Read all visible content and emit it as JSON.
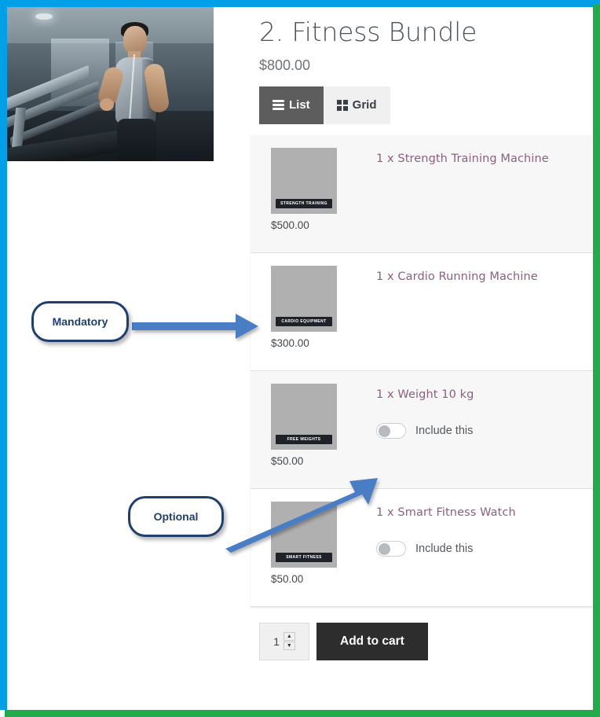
{
  "frame": {
    "top_color": "#00a0e9",
    "left_color": "#00a0e9",
    "right_color": "#22aa4b",
    "bottom_color": "#22aa4b"
  },
  "hero": {
    "alt": "man running on treadmill in gym",
    "icon": "hero-photo"
  },
  "bundle": {
    "title": "2. Fitness Bundle",
    "price": "$800.00"
  },
  "view_switch": {
    "list_label": "List",
    "grid_label": "Grid",
    "active": "List"
  },
  "products": [
    {
      "title": "1 x Strength Training Machine",
      "price": "$500.00",
      "badge": "STRENGTH TRAINING",
      "has_toggle": false,
      "toggle_label": "",
      "toggle_on": false,
      "shaded": true
    },
    {
      "title": "1 x Cardio Running Machine",
      "price": "$300.00",
      "badge": "CARDIO EQUIPMENT",
      "has_toggle": false,
      "toggle_label": "",
      "toggle_on": false,
      "shaded": false
    },
    {
      "title": "1 x Weight 10 kg",
      "price": "$50.00",
      "badge": "FREE WEIGHTS",
      "has_toggle": true,
      "toggle_label": "Include this",
      "toggle_on": false,
      "shaded": true
    },
    {
      "title": "1 x Smart Fitness Watch",
      "price": "$50.00",
      "badge": "SMART FITNESS",
      "has_toggle": true,
      "toggle_label": "Include this",
      "toggle_on": false,
      "shaded": false
    }
  ],
  "cart": {
    "quantity": "1",
    "increment_glyph": "▲",
    "decrement_glyph": "▼",
    "add_to_cart_label": "Add to cart"
  },
  "annotations": {
    "mandatory_label": "Mandatory",
    "optional_label": "Optional",
    "arrow_color": "#4a7ec4",
    "callout_border_color": "#1f3f6e"
  }
}
